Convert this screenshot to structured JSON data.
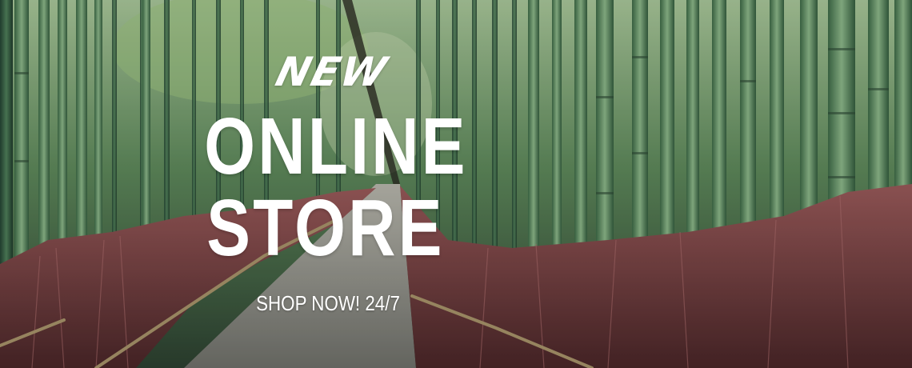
{
  "banner": {
    "tagline": "NEW",
    "title_line1": "ONLINE",
    "title_line2": "STORE",
    "cta": "SHOP NOW! 24/7"
  },
  "colors": {
    "text": "#ffffff",
    "bamboo_light": "#7fae7a",
    "bamboo_dark": "#2f5a3a",
    "undergrowth": "#7a3a3f",
    "path": "#8f918a"
  }
}
